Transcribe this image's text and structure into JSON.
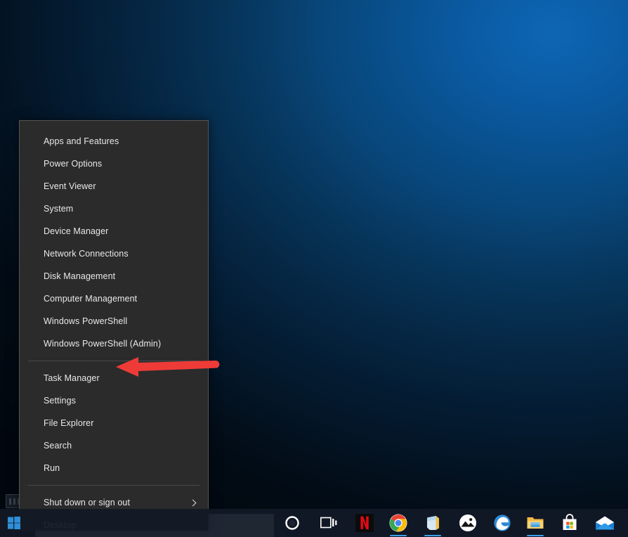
{
  "desktop": {
    "wallpaper_color_bright": "#0e66b4",
    "wallpaper_color_dark": "#041020",
    "desktop_icon_label": ""
  },
  "winx_menu": {
    "groups": [
      {
        "items": [
          {
            "label": "Apps and Features",
            "has_submenu": false
          },
          {
            "label": "Power Options",
            "has_submenu": false
          },
          {
            "label": "Event Viewer",
            "has_submenu": false
          },
          {
            "label": "System",
            "has_submenu": false
          },
          {
            "label": "Device Manager",
            "has_submenu": false
          },
          {
            "label": "Network Connections",
            "has_submenu": false
          },
          {
            "label": "Disk Management",
            "has_submenu": false
          },
          {
            "label": "Computer Management",
            "has_submenu": false
          },
          {
            "label": "Windows PowerShell",
            "has_submenu": false
          },
          {
            "label": "Windows PowerShell (Admin)",
            "has_submenu": false
          }
        ]
      },
      {
        "items": [
          {
            "label": "Task Manager",
            "has_submenu": false
          },
          {
            "label": "Settings",
            "has_submenu": false
          },
          {
            "label": "File Explorer",
            "has_submenu": false
          },
          {
            "label": "Search",
            "has_submenu": false
          },
          {
            "label": "Run",
            "has_submenu": false
          }
        ]
      },
      {
        "items": [
          {
            "label": "Shut down or sign out",
            "has_submenu": true
          },
          {
            "label": "Desktop",
            "has_submenu": false
          }
        ]
      }
    ]
  },
  "annotation": {
    "arrow_color": "#ef3b38",
    "arrow_points_to": "Task Manager"
  },
  "taskbar": {
    "start_button": "start-button",
    "search": {
      "placeholder": "",
      "value": ""
    },
    "items": [
      {
        "name": "cortana-icon",
        "label": "Cortana",
        "running": false
      },
      {
        "name": "task-view-icon",
        "label": "Task View",
        "running": false
      },
      {
        "name": "netflix-icon",
        "label": "Netflix",
        "running": false
      },
      {
        "name": "chrome-icon",
        "label": "Google Chrome",
        "running": true
      },
      {
        "name": "sticky-notes-icon",
        "label": "Sticky Notes",
        "running": true
      },
      {
        "name": "photos-icon",
        "label": "Photos",
        "running": false
      },
      {
        "name": "edge-icon",
        "label": "Microsoft Edge",
        "running": false
      },
      {
        "name": "file-explorer-icon",
        "label": "File Explorer",
        "running": true
      },
      {
        "name": "microsoft-store-icon",
        "label": "Microsoft Store",
        "running": false
      },
      {
        "name": "mail-icon",
        "label": "Mail",
        "running": false
      }
    ]
  }
}
